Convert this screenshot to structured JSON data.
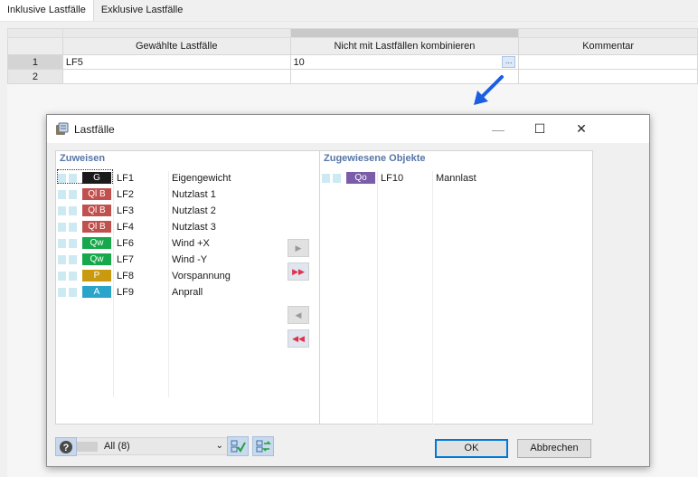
{
  "tabs": {
    "inclusive": "Inklusive Lastfälle",
    "exclusive": "Exklusive Lastfälle"
  },
  "table": {
    "headers": [
      "Gewählte Lastfälle",
      "Nicht mit Lastfällen kombinieren",
      "Kommentar"
    ],
    "rows": [
      {
        "num": "1",
        "selected": "LF5",
        "exclude": "10",
        "comment": ""
      },
      {
        "num": "2",
        "selected": "",
        "exclude": "",
        "comment": ""
      }
    ],
    "ellipsis": "..."
  },
  "dialog": {
    "title": "Lastfälle",
    "window_controls": {
      "minimize": "—",
      "maximize": "☐",
      "close": "✕"
    },
    "assign_title": "Zuweisen",
    "assigned_title": "Zugewiesene Objekte",
    "available": [
      {
        "badge": "G",
        "badge_color": "#1a1a1a",
        "lf": "LF1",
        "name": "Eigengewicht"
      },
      {
        "badge": "Ql B",
        "badge_color": "#c0504d",
        "lf": "LF2",
        "name": "Nutzlast 1"
      },
      {
        "badge": "Ql B",
        "badge_color": "#c0504d",
        "lf": "LF3",
        "name": "Nutzlast 2"
      },
      {
        "badge": "Ql B",
        "badge_color": "#c0504d",
        "lf": "LF4",
        "name": "Nutzlast 3"
      },
      {
        "badge": "Qw",
        "badge_color": "#16a84a",
        "lf": "LF6",
        "name": "Wind +X"
      },
      {
        "badge": "Qw",
        "badge_color": "#16a84a",
        "lf": "LF7",
        "name": "Wind -Y"
      },
      {
        "badge": "P",
        "badge_color": "#c99a10",
        "lf": "LF8",
        "name": "Vorspannung"
      },
      {
        "badge": "A",
        "badge_color": "#2aa5c9",
        "lf": "LF9",
        "name": "Anprall"
      }
    ],
    "assigned": [
      {
        "badge": "Qo",
        "badge_color": "#7b5ca8",
        "lf": "LF10",
        "name": "Mannlast"
      }
    ],
    "move_buttons": {
      "add": "▶",
      "add_all": "▶▶",
      "remove": "◀",
      "remove_all": "◀◀"
    },
    "filter": {
      "value": "All (8)"
    },
    "buttons": {
      "ok": "OK",
      "cancel": "Abbrechen"
    },
    "icons": {
      "title": "load-cases-icon",
      "select_all": "select-all-icon",
      "toggle": "toggle-selection-icon",
      "help": "help-icon",
      "caret": "chevron-down-icon"
    }
  }
}
